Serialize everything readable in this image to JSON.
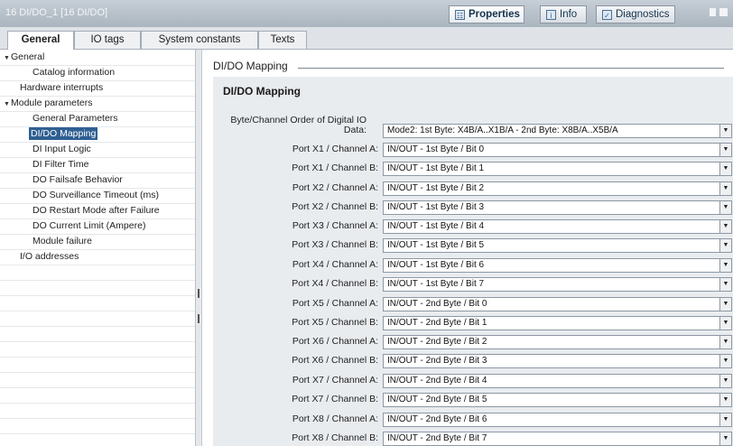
{
  "window": {
    "title": "16 DI/DO_1 [16 DI/DO]",
    "top_tabs": [
      {
        "label": "Properties",
        "icon": "properties-icon",
        "active": true
      },
      {
        "label": "Info",
        "icon": "info-icon",
        "active": false
      },
      {
        "label": "Diagnostics",
        "icon": "diagnostics-icon",
        "active": false
      }
    ]
  },
  "tabs": [
    "General",
    "IO tags",
    "System constants",
    "Texts"
  ],
  "nav": [
    {
      "label": "General",
      "expanded": true
    },
    {
      "label": "Catalog information"
    },
    {
      "label": "Hardware interrupts"
    },
    {
      "label": "Module parameters",
      "expanded": true
    },
    {
      "label": "General Parameters"
    },
    {
      "label": "DI/DO Mapping",
      "selected": true
    },
    {
      "label": "DI Input Logic"
    },
    {
      "label": "DI Filter Time"
    },
    {
      "label": "DO Failsafe Behavior"
    },
    {
      "label": "DO Surveillance Timeout (ms)"
    },
    {
      "label": "DO Restart Mode after Failure"
    },
    {
      "label": "DO Current Limit (Ampere)"
    },
    {
      "label": "Module failure"
    },
    {
      "label": "I/O addresses"
    }
  ],
  "content": {
    "section_header": "DI/DO Mapping",
    "panel_title": "DI/DO Mapping",
    "order_label_line1": "Byte/Channel Order of Digital IO",
    "order_label_line2": "Data:",
    "order_value": "Mode2: 1st Byte: X4B/A..X1B/A - 2nd Byte: X8B/A..X5B/A",
    "ports": [
      {
        "label": "Port X1 / Channel A:",
        "value": "IN/OUT - 1st Byte / Bit 0"
      },
      {
        "label": "Port X1 / Channel B:",
        "value": "IN/OUT - 1st Byte / Bit 1"
      },
      {
        "label": "Port X2 / Channel A:",
        "value": "IN/OUT - 1st Byte / Bit 2"
      },
      {
        "label": "Port X2 / Channel B:",
        "value": "IN/OUT - 1st Byte / Bit 3"
      },
      {
        "label": "Port X3 / Channel A:",
        "value": "IN/OUT - 1st Byte / Bit 4"
      },
      {
        "label": "Port X3 / Channel B:",
        "value": "IN/OUT - 1st Byte / Bit 5"
      },
      {
        "label": "Port X4 / Channel A:",
        "value": "IN/OUT - 1st Byte / Bit 6"
      },
      {
        "label": "Port X4 / Channel B:",
        "value": "IN/OUT - 1st Byte / Bit 7"
      },
      {
        "label": "Port X5 / Channel A:",
        "value": "IN/OUT - 2nd Byte / Bit 0"
      },
      {
        "label": "Port X5 / Channel B:",
        "value": "IN/OUT - 2nd Byte / Bit 1"
      },
      {
        "label": "Port X6 / Channel A:",
        "value": "IN/OUT - 2nd Byte / Bit 2"
      },
      {
        "label": "Port X6 / Channel B:",
        "value": "IN/OUT - 2nd Byte / Bit 3"
      },
      {
        "label": "Port X7 / Channel A:",
        "value": "IN/OUT - 2nd Byte / Bit 4"
      },
      {
        "label": "Port X7 / Channel B:",
        "value": "IN/OUT - 2nd Byte / Bit 5"
      },
      {
        "label": "Port X8 / Channel A:",
        "value": "IN/OUT - 2nd Byte / Bit 6"
      },
      {
        "label": "Port X8 / Channel B:",
        "value": "IN/OUT - 2nd Byte / Bit 7"
      }
    ]
  },
  "colors": {
    "selection": "#2f5f92",
    "panel_bg": "#e9ecef",
    "titlebar": "#aab5bf"
  }
}
